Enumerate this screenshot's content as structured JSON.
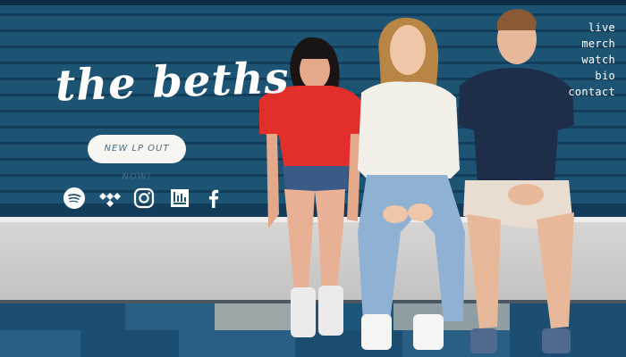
{
  "brand": {
    "logo_text": "the beths"
  },
  "cta": {
    "label": "NEW LP OUT NOW!"
  },
  "nav": {
    "items": [
      "live",
      "merch",
      "watch",
      "bio",
      "contact"
    ]
  },
  "social": {
    "icons": [
      "spotify-icon",
      "tidal-icon",
      "instagram-icon",
      "bandcamp-icon",
      "facebook-icon"
    ]
  },
  "colors": {
    "wall": "#1d5474",
    "bench": "#d6d4d2",
    "cta_bg": "#f8f6f2",
    "cta_text": "#4b6c85",
    "text": "#ffffff"
  }
}
